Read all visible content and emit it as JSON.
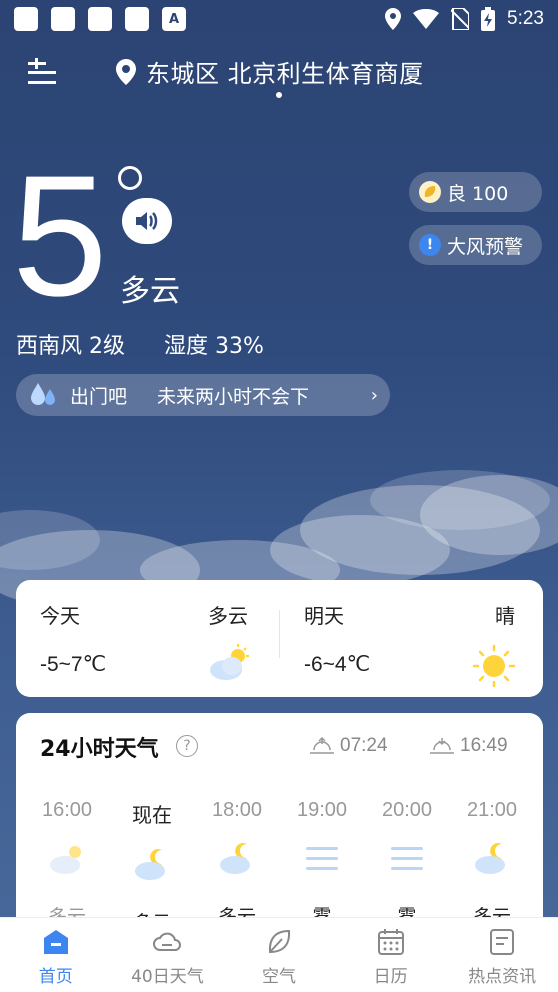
{
  "status_bar": {
    "time": "5:23",
    "a_badge": "A"
  },
  "location": {
    "name": "东城区 北京利生体育商厦"
  },
  "current": {
    "temperature": "5",
    "condition": "多云",
    "wind": "西南风 2级",
    "humidity": "湿度 33%"
  },
  "aqi": {
    "label": "良 100",
    "color": "#f5c542"
  },
  "warning": {
    "label": "大风预警",
    "icon_text": "!",
    "color": "#3d86f0"
  },
  "rain_notice": {
    "left": "出门吧",
    "right": "未来两小时不会下"
  },
  "days": [
    {
      "label": "今天",
      "condition": "多云",
      "temp": "-5~7℃",
      "icon": "partly-cloudy-icon"
    },
    {
      "label": "明天",
      "condition": "晴",
      "temp": "-6~4℃",
      "icon": "sunny-icon"
    }
  ],
  "hourly": {
    "title": "24小时天气",
    "help": "?",
    "sunrise": "07:24",
    "sunset": "16:49",
    "hours": [
      {
        "time": "16:00",
        "condition": "多云",
        "icon": "partly-cloudy-day-icon"
      },
      {
        "time": "现在",
        "condition": "多云",
        "icon": "partly-cloudy-night-icon"
      },
      {
        "time": "18:00",
        "condition": "多云",
        "icon": "partly-cloudy-night-icon"
      },
      {
        "time": "19:00",
        "condition": "雾",
        "icon": "fog-icon"
      },
      {
        "time": "20:00",
        "condition": "雾",
        "icon": "fog-icon"
      },
      {
        "time": "21:00",
        "condition": "多云",
        "icon": "partly-cloudy-night-icon"
      }
    ]
  },
  "nav": [
    {
      "label": "首页",
      "icon": "home-icon"
    },
    {
      "label": "40日天气",
      "icon": "cloud-icon"
    },
    {
      "label": "空气",
      "icon": "leaf-icon"
    },
    {
      "label": "日历",
      "icon": "calendar-icon"
    },
    {
      "label": "热点资讯",
      "icon": "news-icon"
    }
  ],
  "colors": {
    "accent": "#3d86f0",
    "background": "#2f4a7c"
  }
}
